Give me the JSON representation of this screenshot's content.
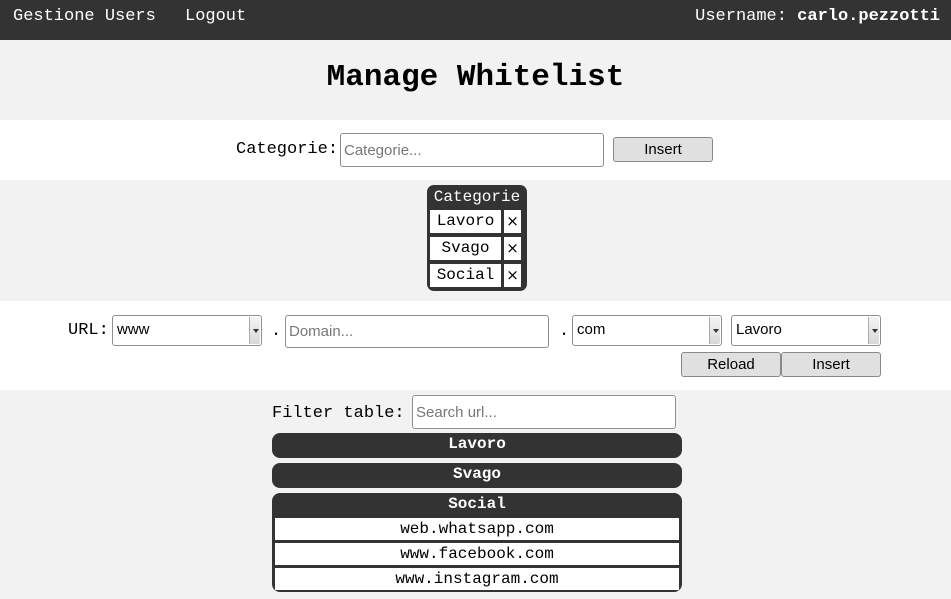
{
  "topbar": {
    "nav_users": "Gestione Users",
    "nav_logout": "Logout",
    "username_label": "Username:",
    "username_value": "carlo.pezzotti"
  },
  "page": {
    "title": "Manage Whitelist"
  },
  "category_form": {
    "label": "Categorie:",
    "placeholder": "Categorie...",
    "insert_label": "Insert"
  },
  "category_table": {
    "header": "Categorie",
    "delete_symbol": "×",
    "items": [
      "Lavoro",
      "Svago",
      "Social"
    ]
  },
  "url_form": {
    "label": "URL:",
    "prefix_value": "www",
    "dot": ".",
    "domain_placeholder": "Domain...",
    "tld_value": "com",
    "category_value": "Lavoro",
    "reload_label": "Reload",
    "insert_label": "Insert"
  },
  "filter": {
    "label": "Filter table:",
    "placeholder": "Search url..."
  },
  "groups": [
    {
      "name": "Lavoro",
      "urls": []
    },
    {
      "name": "Svago",
      "urls": []
    },
    {
      "name": "Social",
      "urls": [
        "web.whatsapp.com",
        "www.facebook.com",
        "www.instagram.com"
      ]
    }
  ]
}
